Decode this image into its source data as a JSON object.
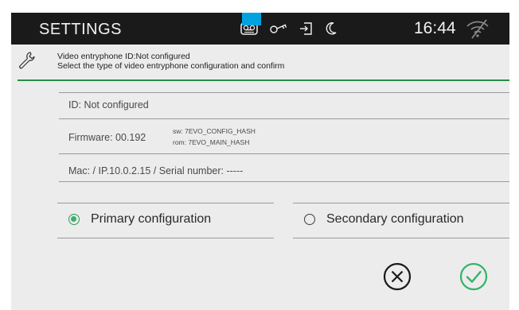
{
  "topbar": {
    "title": "SETTINGS",
    "time": "16:44",
    "status_icons": [
      "voicemail-icon",
      "key-icon",
      "door-exit-icon",
      "moon-icon"
    ],
    "wifi_icon": "wifi-off-icon",
    "notch_color": "#00a3e0"
  },
  "header": {
    "icon": "wrench-icon",
    "line1": "Video entryphone ID:Not configured",
    "line2": "Select the type of video entryphone configuration and confirm",
    "accent_color": "#2a8c4a"
  },
  "details": {
    "id_text": "ID: Not configured",
    "firmware_label": "Firmware: 00.192",
    "sw_hash": "sw: 7EVO_CONFIG_HASH",
    "rom_hash": "rom: 7EVO_MAIN_HASH",
    "network_text": "Mac:  / IP.10.0.2.15 / Serial number: -----"
  },
  "options": {
    "primary_label": "Primary configuration",
    "secondary_label": "Secondary configuration",
    "selected": "primary",
    "selected_color": "#34b36a"
  },
  "actions": {
    "cancel_icon": "cancel-icon",
    "confirm_icon": "confirm-check-icon",
    "confirm_color": "#34b36a"
  }
}
